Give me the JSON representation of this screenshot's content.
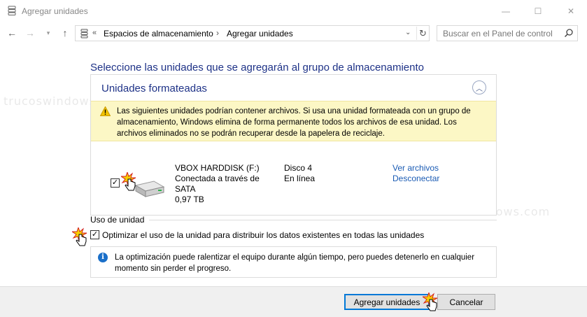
{
  "window": {
    "title": "Agregar unidades",
    "controls": {
      "minimize": "—",
      "maximize": "☐",
      "close": "✕"
    }
  },
  "nav": {
    "back": "←",
    "forward": "→",
    "recent": "▾",
    "up": "↑",
    "address": {
      "overflow": "«",
      "crumbs": [
        "Espacios de almacenamiento",
        "Agregar unidades"
      ],
      "separator": "›",
      "dropdown": "⌄",
      "refresh": "↻"
    },
    "search": {
      "placeholder": "Buscar en el Panel de control"
    }
  },
  "main": {
    "heading": "Seleccione las unidades que se agregarán al grupo de almacenamiento",
    "panel": {
      "title": "Unidades formateadas",
      "collapse": "︿",
      "warning": "Las siguientes unidades podrían contener archivos. Si usa una unidad formateada con un grupo de almacenamiento, Windows elimina de forma permanente todos los archivos de esa unidad. Los archivos eliminados no se podrán recuperar desde la papelera de reciclaje.",
      "drive": {
        "checked": "✓",
        "name": "VBOX HARDDISK (F:)",
        "connection": "Conectada a través de SATA",
        "size": "0,97 TB",
        "disk": "Disco 4",
        "status": "En línea",
        "view_files": "Ver archivos",
        "disconnect": "Desconectar"
      }
    },
    "usage": {
      "label": "Uso de unidad",
      "optimize_checked": "✓",
      "optimize_label": "Optimizar el uso de la unidad para distribuir los datos existentes en todas las unidades"
    },
    "info": {
      "icon": "i",
      "text": "La optimización puede ralentizar el equipo durante algún tiempo, pero puedes detenerlo en cualquier momento sin perder el progreso."
    }
  },
  "footer": {
    "add": "Agregar unidades",
    "cancel": "Cancelar"
  },
  "watermark": "truco​swindows.com"
}
